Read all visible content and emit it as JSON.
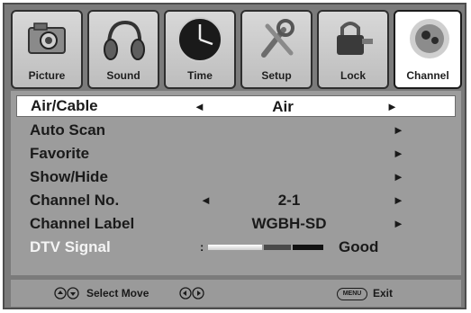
{
  "tabs": [
    {
      "label": "Picture",
      "icon": "camera-icon",
      "active": false
    },
    {
      "label": "Sound",
      "icon": "headphones-icon",
      "active": false
    },
    {
      "label": "Time",
      "icon": "clock-icon",
      "active": false
    },
    {
      "label": "Setup",
      "icon": "tools-icon",
      "active": false
    },
    {
      "label": "Lock",
      "icon": "lock-icon",
      "active": false
    },
    {
      "label": "Channel",
      "icon": "satellite-dish-icon",
      "active": true
    }
  ],
  "menu": {
    "air_cable": {
      "label": "Air/Cable",
      "value": "Air"
    },
    "auto_scan": {
      "label": "Auto Scan"
    },
    "favorite": {
      "label": "Favorite"
    },
    "show_hide": {
      "label": "Show/Hide"
    },
    "channel_no": {
      "label": "Channel No.",
      "value": "2-1"
    },
    "channel_label": {
      "label": "Channel Label",
      "value": "WGBH-SD"
    },
    "dtv_signal": {
      "label": "DTV Signal",
      "value": "Good",
      "level": 1.0
    }
  },
  "footer": {
    "select_move": "Select Move",
    "menu_key": "MENU",
    "exit": "Exit"
  },
  "colors": {
    "frame": "#7b7b7b",
    "panel": "#9c9c9c",
    "selected_row": "#ffffff",
    "dim_text": "#f4f4f4"
  }
}
